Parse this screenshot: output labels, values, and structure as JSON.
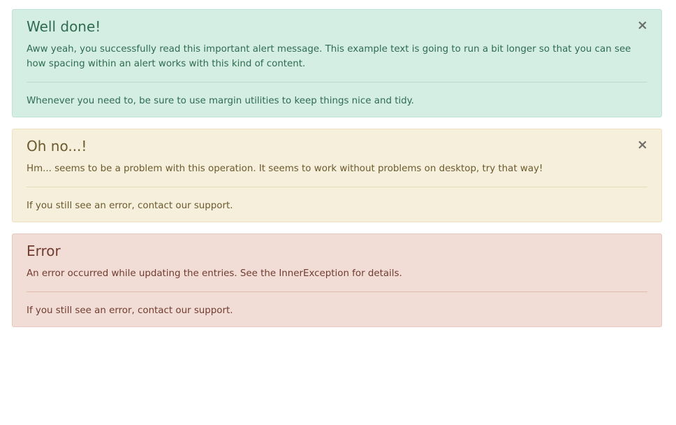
{
  "alerts": [
    {
      "type": "success",
      "heading": "Well done!",
      "message": "Aww yeah, you successfully read this important alert message. This example text is going to run a bit longer so that you can see how spacing within an alert works with this kind of content.",
      "footer": "Whenever you need to, be sure to use margin utilities to keep things nice and tidy.",
      "dismissible": true,
      "close_icon": "×",
      "colors": {
        "background": "#d4eee4",
        "text": "#2f6b52"
      }
    },
    {
      "type": "warning",
      "heading": "Oh no...!",
      "message": "Hm... seems to be a problem with this operation. It seems to work without problems on desktop, try that way!",
      "footer": "If you still see an error, contact our support.",
      "dismissible": true,
      "close_icon": "×",
      "colors": {
        "background": "#f6efdb",
        "text": "#6b5a2e"
      }
    },
    {
      "type": "danger",
      "heading": "Error",
      "message": "An error occurred while updating the entries. See the InnerException for details.",
      "footer": "If you still see an error, contact our support.",
      "dismissible": false,
      "colors": {
        "background": "#f1dcd6",
        "text": "#713c30"
      }
    }
  ]
}
